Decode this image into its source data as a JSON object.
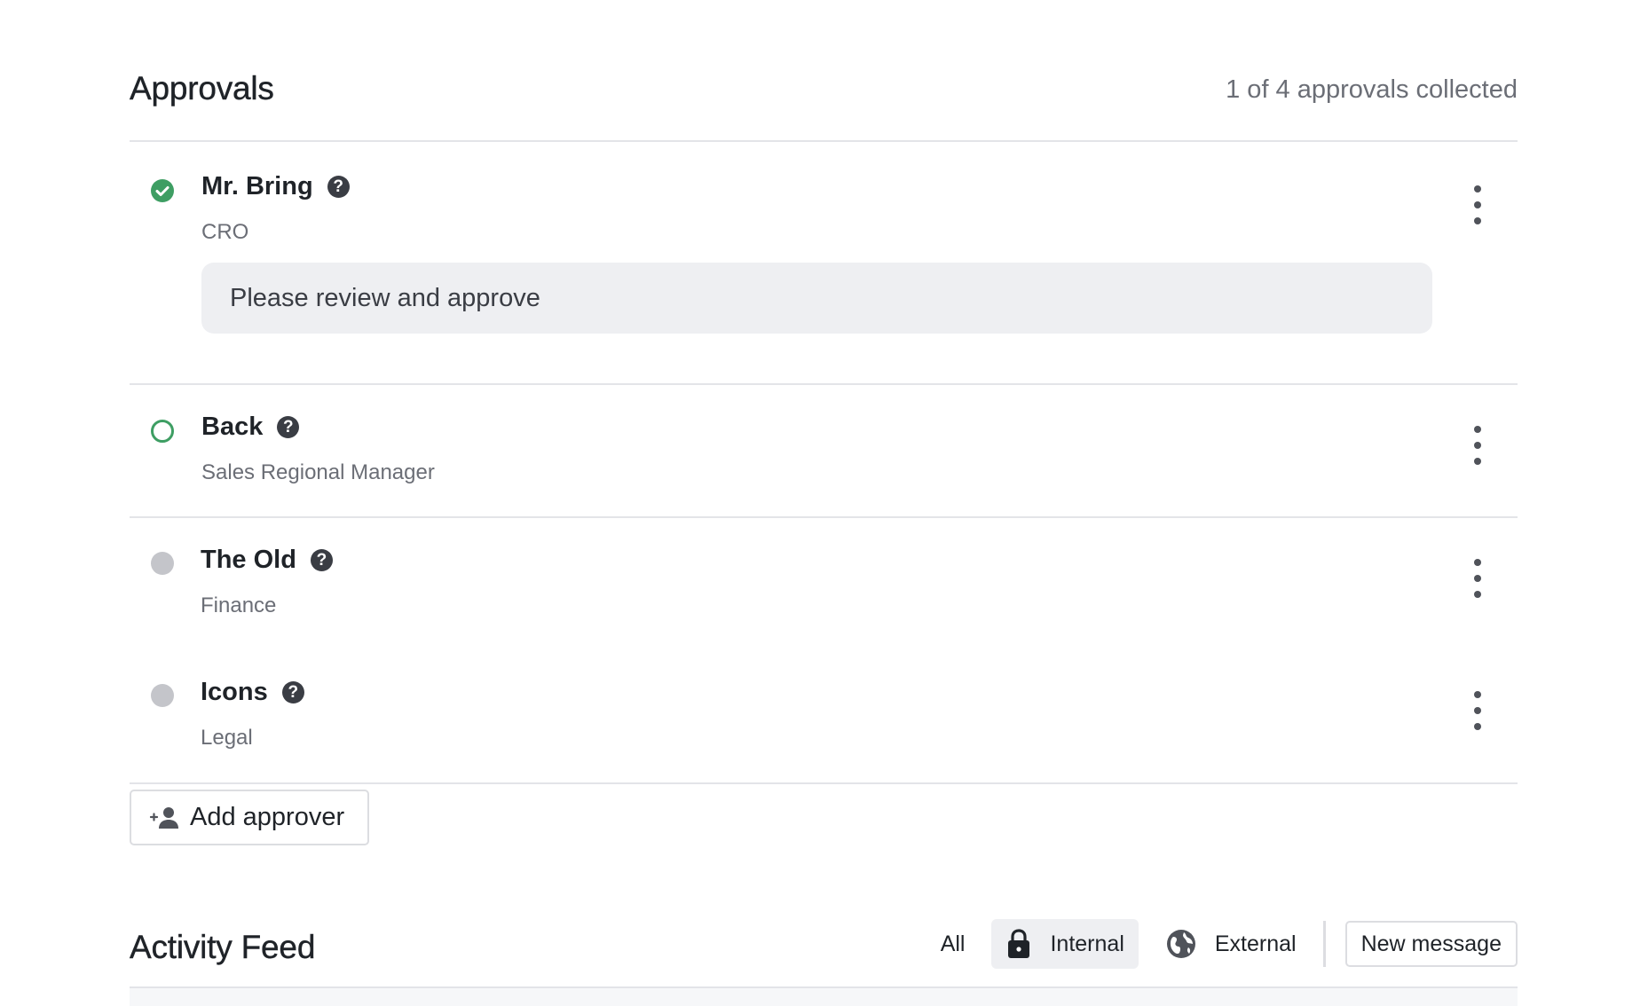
{
  "approvals": {
    "title": "Approvals",
    "count_text": "1 of 4 approvals collected",
    "approvers": [
      {
        "name": "Mr. Bring",
        "role": "CRO",
        "status": "approved",
        "status_icon": "check-circle-icon",
        "message": "Please review and approve"
      },
      {
        "name": "Back",
        "role": "Sales Regional Manager",
        "status": "pending",
        "status_icon": "empty-circle-icon"
      },
      {
        "name": "The Old",
        "role": "Finance",
        "status": "waiting",
        "status_icon": "grey-dot-icon"
      },
      {
        "name": "Icons",
        "role": "Legal",
        "status": "waiting",
        "status_icon": "grey-dot-icon"
      }
    ],
    "help_icon_glyph": "?",
    "add_button_label": "Add approver"
  },
  "activity_feed": {
    "title": "Activity Feed",
    "filters": [
      {
        "label": "All",
        "icon": ""
      },
      {
        "label": "Internal",
        "icon": "lock-icon",
        "active": true
      },
      {
        "label": "External",
        "icon": "globe-icon"
      }
    ],
    "new_message_label": "New message"
  },
  "colors": {
    "approved_green": "#3e9e63",
    "waiting_grey": "#c4c5ca",
    "message_bg": "#eeeff2",
    "divider": "#e3e4e8"
  }
}
